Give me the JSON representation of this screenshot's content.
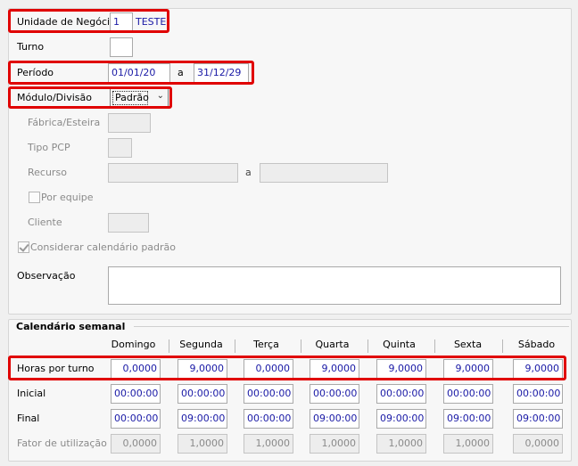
{
  "form": {
    "unidade_label": "Unidade de Negócio",
    "unidade_code": "1",
    "unidade_name": "TESTE",
    "turno_label": "Turno",
    "turno_value": "",
    "periodo_label": "Período",
    "periodo_start": "01/01/20",
    "periodo_sep": "a",
    "periodo_end": "31/12/29",
    "modulo_label": "Módulo/Divisão",
    "modulo_value": "Padrão",
    "fabrica_label": "Fábrica/Esteira",
    "tipo_pcp_label": "Tipo PCP",
    "recurso_label": "Recurso",
    "recurso_sep": "a",
    "por_equipe_label": "Por equipe",
    "cliente_label": "Cliente",
    "considerar_label": "Considerar calendário padrão",
    "observacao_label": "Observação"
  },
  "calendario": {
    "title": "Calendário semanal",
    "days": [
      "Domingo",
      "Segunda",
      "Terça",
      "Quarta",
      "Quinta",
      "Sexta",
      "Sábado"
    ],
    "rows": [
      {
        "label": "Horas por turno",
        "values": [
          "0,0000",
          "9,0000",
          "0,0000",
          "9,0000",
          "9,0000",
          "9,0000",
          "9,0000"
        ]
      },
      {
        "label": "Inicial",
        "values": [
          "00:00:00",
          "00:00:00",
          "00:00:00",
          "00:00:00",
          "00:00:00",
          "00:00:00",
          "00:00:00"
        ]
      },
      {
        "label": "Final",
        "values": [
          "00:00:00",
          "09:00:00",
          "00:00:00",
          "09:00:00",
          "09:00:00",
          "09:00:00",
          "09:00:00"
        ]
      },
      {
        "label": "Fator de utilização",
        "values": [
          "0,0000",
          "1,0000",
          "1,0000",
          "1,0000",
          "1,0000",
          "1,0000",
          "0,0000"
        ]
      }
    ]
  }
}
